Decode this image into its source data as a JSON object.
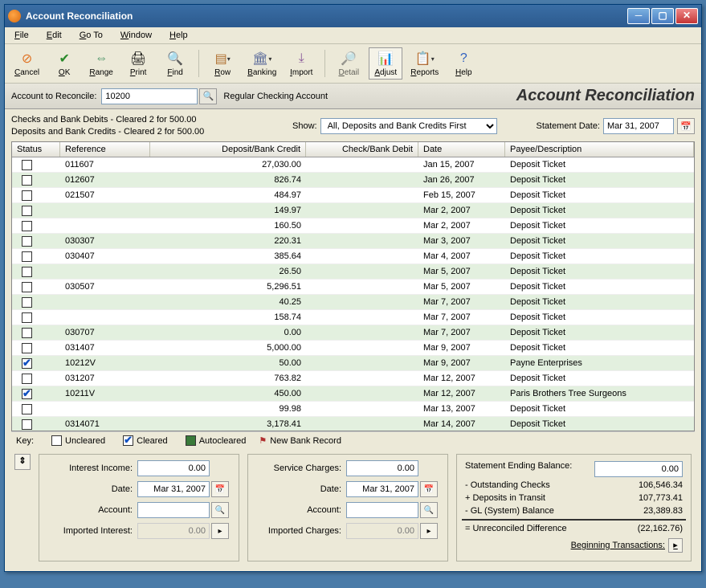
{
  "window": {
    "title": "Account Reconciliation"
  },
  "menu": {
    "file": "File",
    "edit": "Edit",
    "goto": "Go To",
    "window": "Window",
    "help": "Help"
  },
  "toolbar": {
    "cancel": "Cancel",
    "ok": "OK",
    "range": "Range",
    "print": "Print",
    "find": "Find",
    "row": "Row",
    "banking": "Banking",
    "import": "Import",
    "detail": "Detail",
    "adjust": "Adjust",
    "reports": "Reports",
    "help": "Help"
  },
  "acct": {
    "label": "Account to Reconcile:",
    "value": "10200",
    "name": "Regular Checking Account",
    "heading": "Account Reconciliation"
  },
  "summary": {
    "line1": "Checks and Bank Debits -    Cleared 2 for 500.00",
    "line2": "Deposits and Bank Credits - Cleared 2 for 500.00",
    "show_label": "Show:",
    "show_value": "All, Deposits and Bank Credits First",
    "stmt_label": "Statement Date:",
    "stmt_value": "Mar 31, 2007"
  },
  "columns": {
    "status": "Status",
    "ref": "Reference",
    "dep": "Deposit/Bank Credit",
    "chk": "Check/Bank Debit",
    "date": "Date",
    "payee": "Payee/Description"
  },
  "rows": [
    {
      "status": "",
      "ref": "011607",
      "dep": "27,030.00",
      "chk": "",
      "date": "Jan 15, 2007",
      "payee": "Deposit Ticket"
    },
    {
      "status": "",
      "ref": "012607",
      "dep": "826.74",
      "chk": "",
      "date": "Jan 26, 2007",
      "payee": "Deposit Ticket"
    },
    {
      "status": "",
      "ref": "021507",
      "dep": "484.97",
      "chk": "",
      "date": "Feb 15, 2007",
      "payee": "Deposit Ticket"
    },
    {
      "status": "",
      "ref": "",
      "dep": "149.97",
      "chk": "",
      "date": "Mar 2, 2007",
      "payee": "Deposit Ticket"
    },
    {
      "status": "",
      "ref": "",
      "dep": "160.50",
      "chk": "",
      "date": "Mar 2, 2007",
      "payee": "Deposit Ticket"
    },
    {
      "status": "",
      "ref": "030307",
      "dep": "220.31",
      "chk": "",
      "date": "Mar 3, 2007",
      "payee": "Deposit Ticket"
    },
    {
      "status": "",
      "ref": "030407",
      "dep": "385.64",
      "chk": "",
      "date": "Mar 4, 2007",
      "payee": "Deposit Ticket"
    },
    {
      "status": "",
      "ref": "",
      "dep": "26.50",
      "chk": "",
      "date": "Mar 5, 2007",
      "payee": "Deposit Ticket"
    },
    {
      "status": "",
      "ref": "030507",
      "dep": "5,296.51",
      "chk": "",
      "date": "Mar 5, 2007",
      "payee": "Deposit Ticket"
    },
    {
      "status": "",
      "ref": "",
      "dep": "40.25",
      "chk": "",
      "date": "Mar 7, 2007",
      "payee": "Deposit Ticket"
    },
    {
      "status": "",
      "ref": "",
      "dep": "158.74",
      "chk": "",
      "date": "Mar 7, 2007",
      "payee": "Deposit Ticket"
    },
    {
      "status": "",
      "ref": "030707",
      "dep": "0.00",
      "chk": "",
      "date": "Mar 7, 2007",
      "payee": "Deposit Ticket"
    },
    {
      "status": "",
      "ref": "031407",
      "dep": "5,000.00",
      "chk": "",
      "date": "Mar 9, 2007",
      "payee": "Deposit Ticket"
    },
    {
      "status": "cleared",
      "ref": "10212V",
      "dep": "50.00",
      "chk": "",
      "date": "Mar 9, 2007",
      "payee": "Payne Enterprises"
    },
    {
      "status": "",
      "ref": "031207",
      "dep": "763.82",
      "chk": "",
      "date": "Mar 12, 2007",
      "payee": "Deposit Ticket"
    },
    {
      "status": "cleared",
      "ref": "10211V",
      "dep": "450.00",
      "chk": "",
      "date": "Mar 12, 2007",
      "payee": "Paris Brothers Tree Surgeons"
    },
    {
      "status": "",
      "ref": "",
      "dep": "99.98",
      "chk": "",
      "date": "Mar 13, 2007",
      "payee": "Deposit Ticket"
    },
    {
      "status": "",
      "ref": "0314071",
      "dep": "3,178.41",
      "chk": "",
      "date": "Mar 14, 2007",
      "payee": "Deposit Ticket"
    }
  ],
  "key": {
    "label": "Key:",
    "uncleared": "Uncleared",
    "cleared": "Cleared",
    "autocleared": "Autocleared",
    "newrec": "New Bank Record"
  },
  "bottom": {
    "interest_income": "Interest Income:",
    "interest_income_v": "0.00",
    "date": "Date:",
    "date_v": "Mar 31, 2007",
    "account": "Account:",
    "account_v": "",
    "imported_interest": "Imported Interest:",
    "imported_interest_v": "0.00",
    "service_charges": "Service Charges:",
    "service_charges_v": "0.00",
    "sc_date_v": "Mar 31, 2007",
    "sc_account_v": "",
    "imported_charges": "Imported Charges:",
    "imported_charges_v": "0.00",
    "stmt_end": "Statement Ending Balance:",
    "stmt_end_v": "0.00",
    "out_checks": "- Outstanding Checks",
    "out_checks_v": "106,546.34",
    "dep_transit": "+ Deposits in Transit",
    "dep_transit_v": "107,773.41",
    "gl_bal": "- GL (System) Balance",
    "gl_bal_v": "23,389.83",
    "unrec_diff": "= Unreconciled Difference",
    "unrec_diff_v": "(22,162.76)",
    "beg_trans": "Beginning Transactions:"
  }
}
